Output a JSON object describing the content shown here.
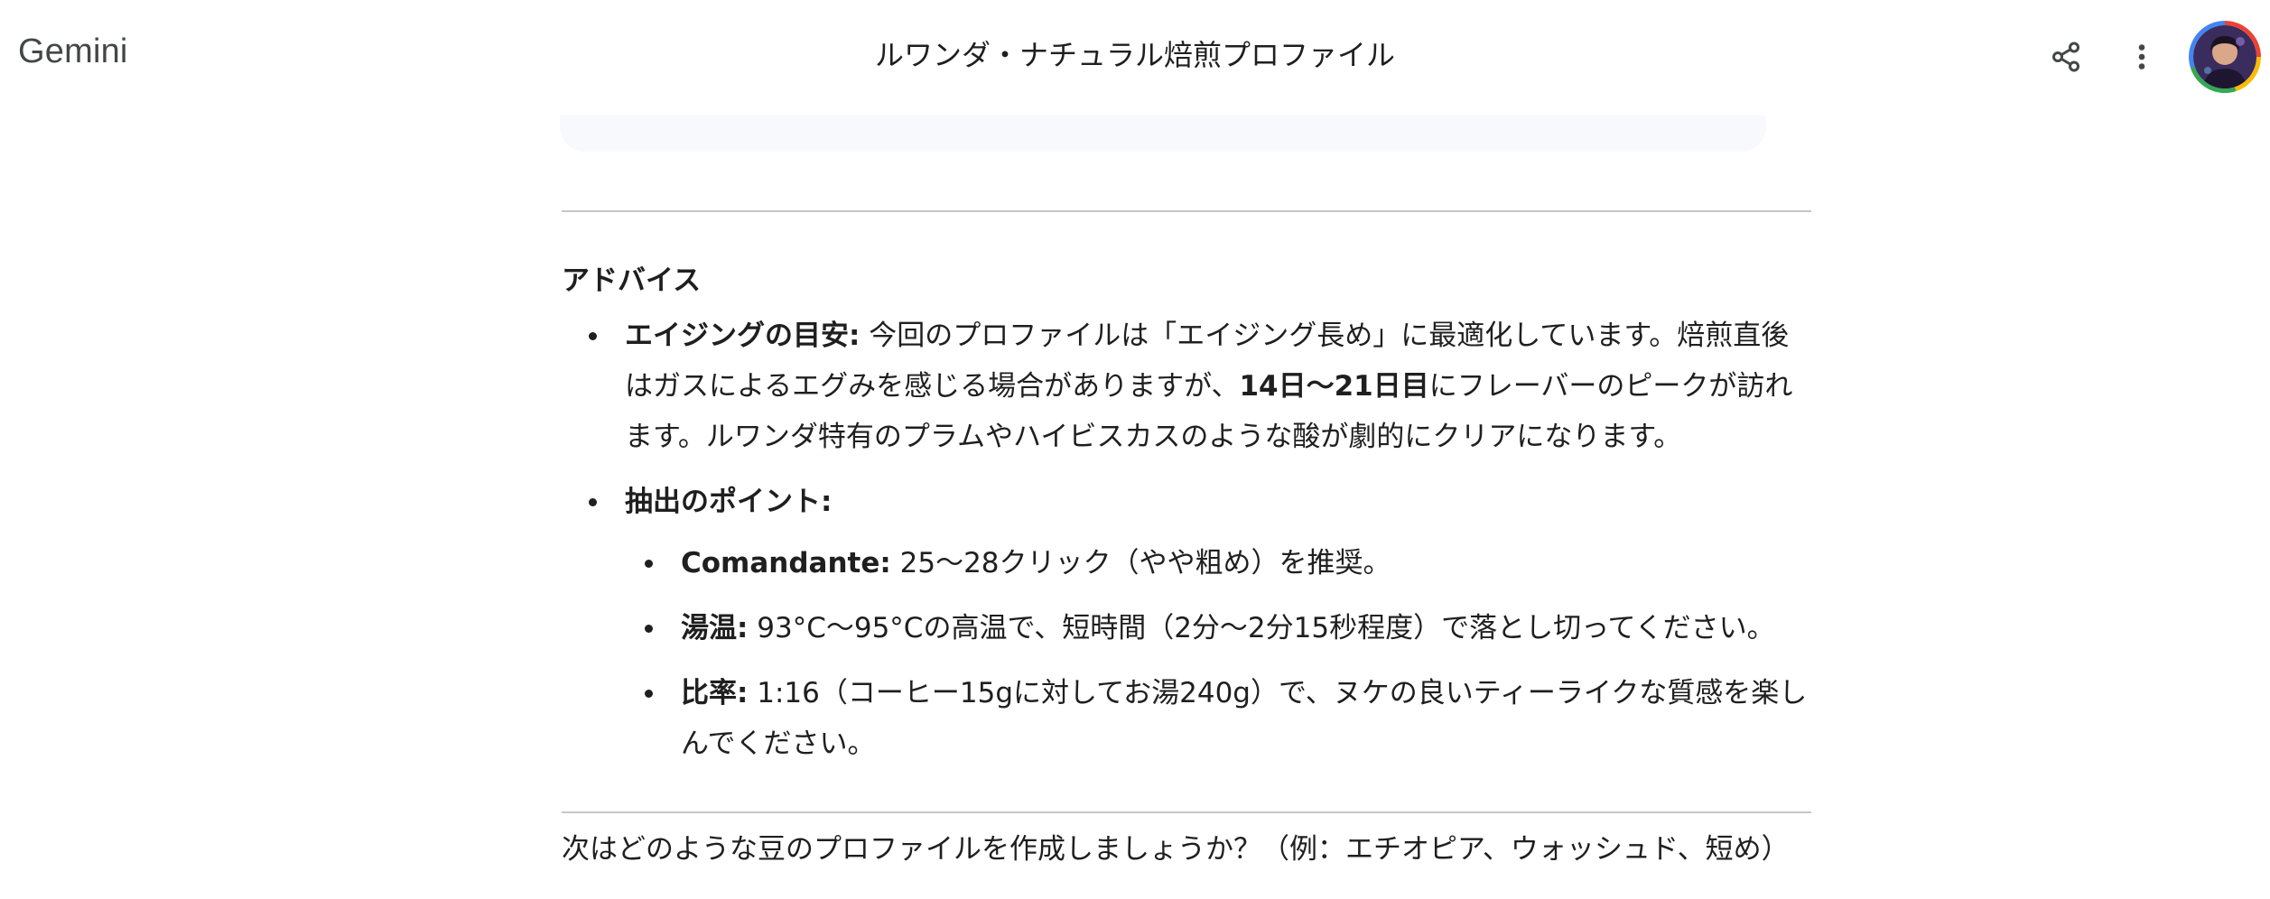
{
  "app": {
    "name": "Gemini"
  },
  "header": {
    "title": "ルワンダ・ナチュラル焙煎プロファイル"
  },
  "icons": {
    "share": "share-icon",
    "more": "more-vert-icon",
    "avatar": "user-avatar"
  },
  "section": {
    "heading": "アドバイス",
    "aging": {
      "label": "エイジングの目安:",
      "text1": " 今回のプロファイルは「エイジング長め」に最適化しています。焙煎直後はガスによるエグみを感じる場合がありますが、",
      "emphasis": "14日〜21日目",
      "text2": "にフレーバーのピークが訪れます。ルワンダ特有のプラムやハイビスカスのような酸が劇的にクリアになります。"
    },
    "extraction": {
      "label": "抽出のポイント:",
      "items": [
        {
          "label": "Comandante:",
          "text": " 25〜28クリック（やや粗め）を推奨。"
        },
        {
          "label": "湯温:",
          "text": " 93°C〜95°Cの高温で、短時間（2分〜2分15秒程度）で落とし切ってください。"
        },
        {
          "label": "比率:",
          "text": " 1:16（コーヒー15gに対してお湯240g）で、ヌケの良いティーライクな質感を楽しんでください。"
        }
      ]
    }
  },
  "closing": "次はどのような豆のプロファイルを作成しましょうか？（例：エチオピア、ウォッシュド、短め）",
  "colors": {
    "text": "#1f1f1f",
    "divider": "#c4c7c5",
    "muted": "#444746"
  }
}
